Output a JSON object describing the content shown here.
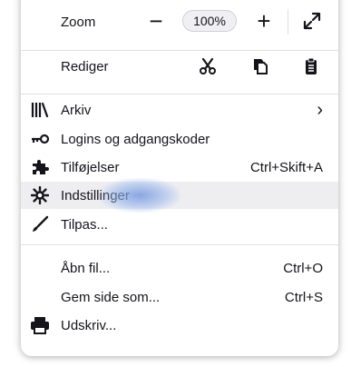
{
  "zoom": {
    "label": "Zoom",
    "zoom_out_symbol": "−",
    "level": "100%",
    "zoom_in_symbol": "+",
    "fullscreen_icon": "fullscreen-icon"
  },
  "edit": {
    "label": "Rediger",
    "cut_icon": "scissors-icon",
    "copy_icon": "copy-icon",
    "paste_icon": "clipboard-icon"
  },
  "items": [
    {
      "label": "Arkiv",
      "icon": "library-icon",
      "shortcut": "›"
    },
    {
      "label": "Logins og adgangskoder",
      "icon": "key-icon",
      "shortcut": ""
    },
    {
      "label": "Tilføjelser",
      "icon": "puzzle-icon",
      "shortcut": "Ctrl+Skift+A"
    },
    {
      "label": "Indstillinger",
      "icon": "gear-icon",
      "shortcut": ""
    },
    {
      "label": "Tilpas...",
      "icon": "brush-icon",
      "shortcut": ""
    }
  ],
  "file_items": [
    {
      "label": "Åbn fil...",
      "shortcut": "Ctrl+O"
    },
    {
      "label": "Gem side som...",
      "shortcut": "Ctrl+S"
    },
    {
      "label": "Udskriv...",
      "icon": "printer-icon",
      "shortcut": ""
    }
  ],
  "colors": {
    "text": "#15141a",
    "hover_bg": "#eeeef1",
    "separator": "#e0e0e6",
    "focus_glow": "#7a9ce1"
  }
}
